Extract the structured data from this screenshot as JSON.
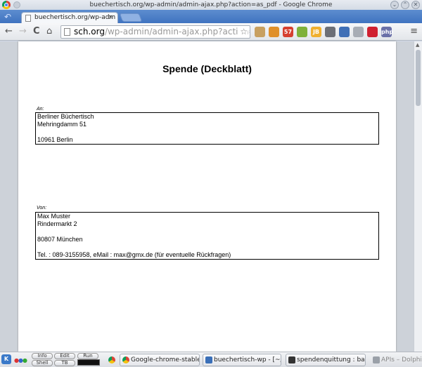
{
  "window": {
    "title": "buechertisch.org/wp-admin/admin-ajax.php?action=as_pdf - Google Chrome",
    "controls": [
      "⌄",
      "⌃",
      "✕"
    ]
  },
  "tabs": [
    {
      "label": "buechertisch.org/wp-adm",
      "close": "×"
    }
  ],
  "toolbar": {
    "back": "←",
    "forward": "→",
    "reload": "C",
    "home": "⌂",
    "url_host": "sch.org",
    "url_path": "/wp-admin/admin-ajax.php?action=as_pdf",
    "star": "☆",
    "menu": "≡",
    "extensions": [
      {
        "name": "ext-icon-1",
        "label": "",
        "color": "#c8a060"
      },
      {
        "name": "ext-icon-2",
        "label": "",
        "color": "#e0902a"
      },
      {
        "name": "ext-icon-3",
        "label": "57",
        "color": "#d64030"
      },
      {
        "name": "ext-icon-4",
        "label": "",
        "color": "#7fb13a"
      },
      {
        "name": "ext-icon-5",
        "label": "JB",
        "color": "#f0b030"
      },
      {
        "name": "ext-icon-6",
        "label": "",
        "color": "#6c6f76"
      },
      {
        "name": "ext-icon-7",
        "label": "",
        "color": "#3f6fb6"
      },
      {
        "name": "ext-icon-8",
        "label": "",
        "color": "#a8adb5"
      },
      {
        "name": "ext-icon-9",
        "label": "",
        "color": "#d02030"
      },
      {
        "name": "ext-icon-10",
        "label": "php",
        "color": "#6a70a8"
      }
    ]
  },
  "document": {
    "title": "Spende (Deckblatt)",
    "to_label": "An:",
    "to_lines": [
      "Berliner Büchertisch",
      "Mehringdamm 51",
      "",
      "10961 Berlin"
    ],
    "from_label": "Von:",
    "from_lines": [
      "Max Muster",
      "Rindermarkt 2",
      "",
      "80807 München",
      "",
      "Tel. : 089-3155958, eMail : max@gmx.de (für eventuelle Rückfragen)"
    ]
  },
  "taskbar": {
    "mini_buttons": [
      "Info",
      "Edit",
      "Run",
      "Shell",
      "TB"
    ],
    "tasks": [
      {
        "label": "Google-chrome-stable",
        "color": "#4285f4"
      },
      {
        "label": "buechertisch-wp - [~/work",
        "color": "#3a6fb8"
      },
      {
        "label": "spendenquittung : bash –",
        "color": "#333333"
      },
      {
        "label": "APIs – Dolphin",
        "color": "#9aa0a8"
      }
    ]
  }
}
